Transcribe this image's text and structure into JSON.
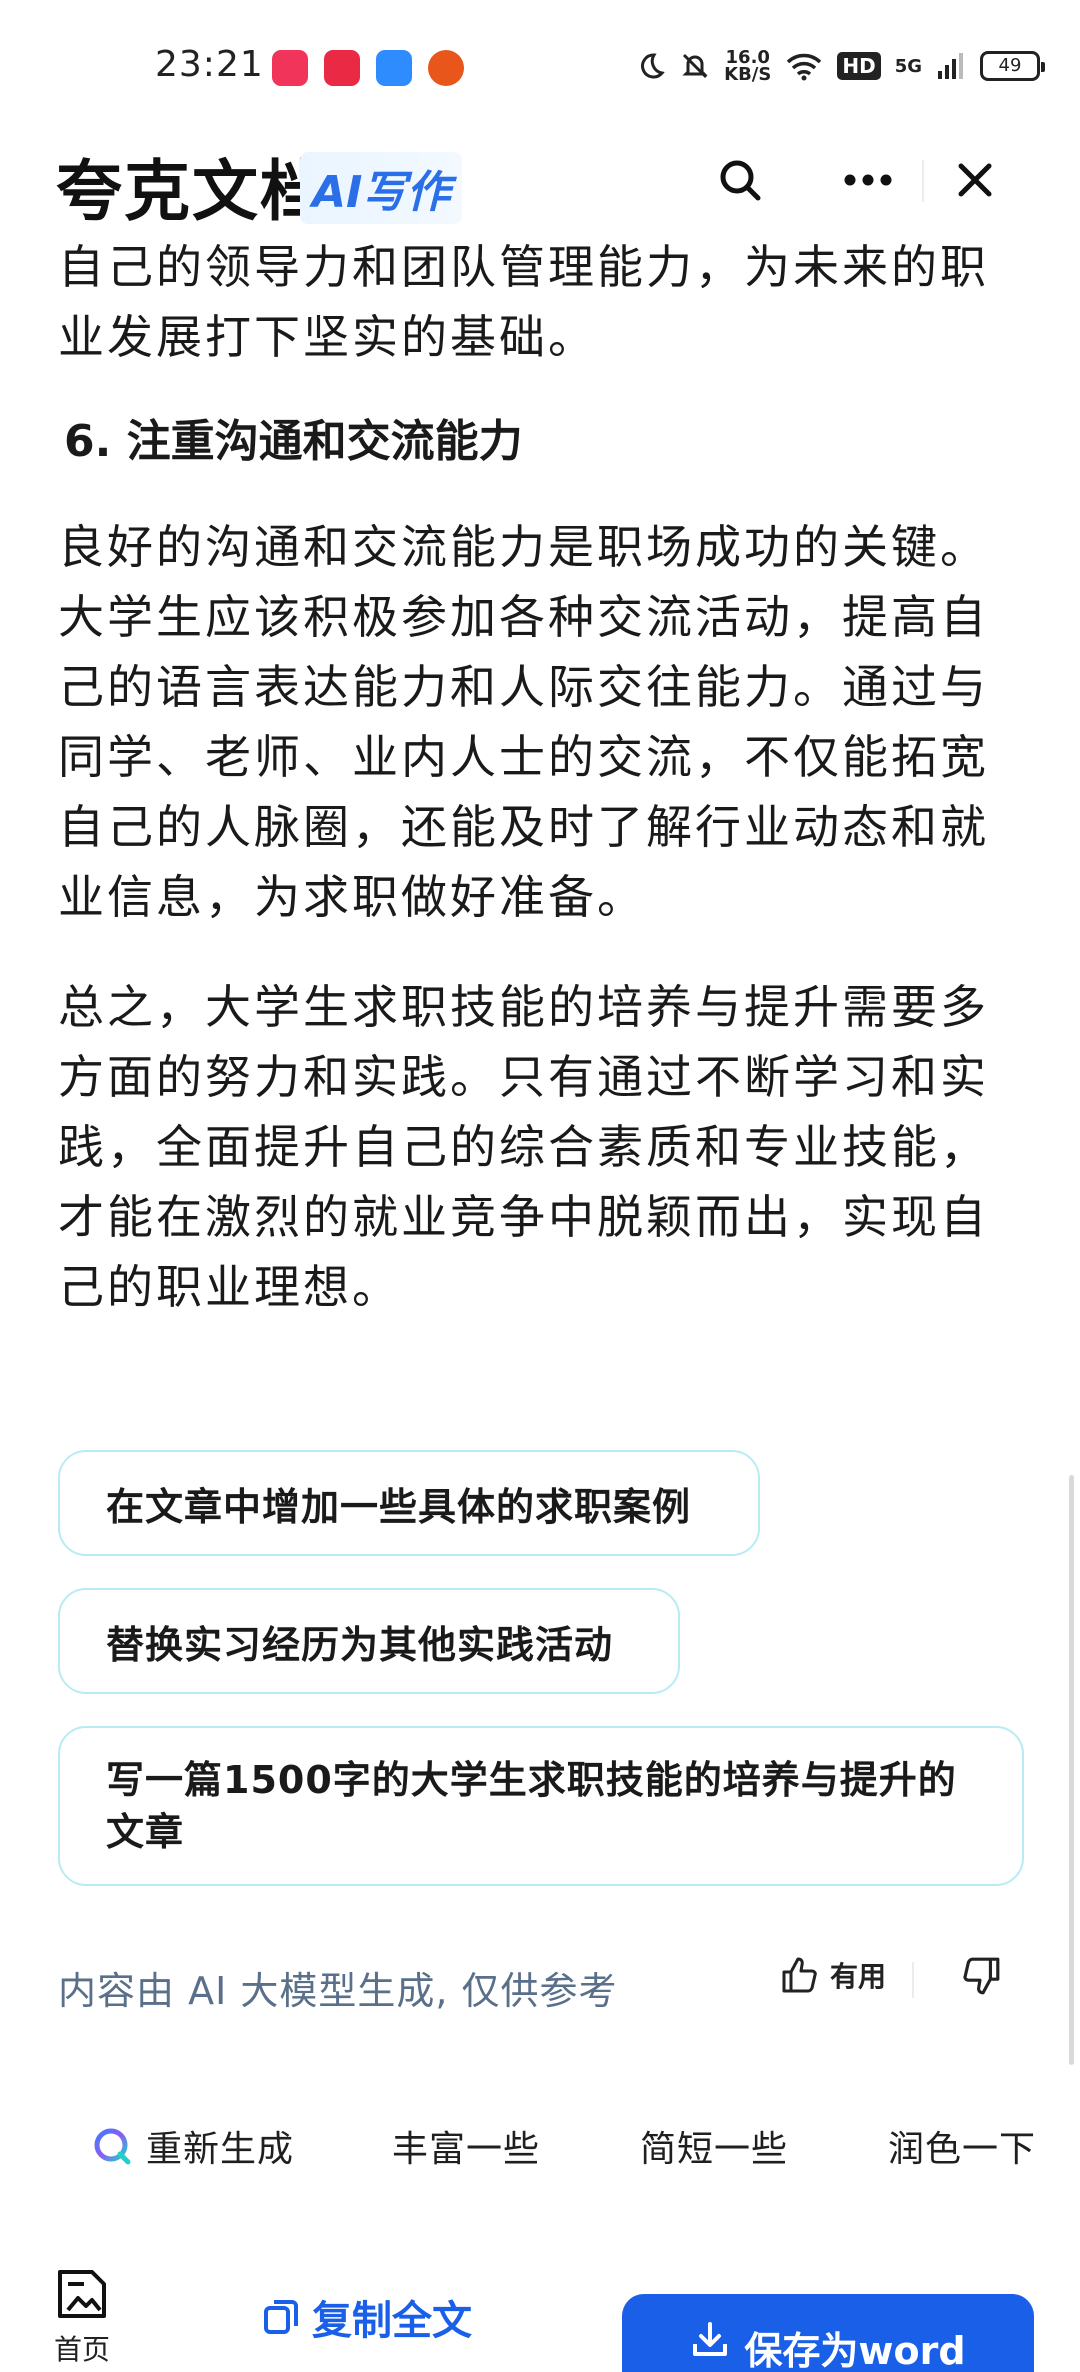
{
  "status_bar": {
    "time": "23:21",
    "network_speed_value": "16.0",
    "network_speed_unit": "KB/S",
    "hd_label": "HD",
    "network_type": "5G",
    "battery": "49",
    "icons": [
      "moon-icon",
      "mute-bell-icon",
      "wifi-icon",
      "signal-icon"
    ],
    "app_icons": [
      {
        "name": "screen-record-app-icon",
        "color": "#f0345a"
      },
      {
        "name": "xiaohongshu-app-icon",
        "color": "#ea2a45"
      },
      {
        "name": "chat-app-icon",
        "color": "#2f8cff"
      },
      {
        "name": "game-app-icon",
        "color": "#e8561c"
      }
    ]
  },
  "header": {
    "brand": "夸克文档",
    "ai_badge": "AI写作",
    "icons": [
      "search-icon",
      "more-icon",
      "close-icon"
    ]
  },
  "content": {
    "paragraph_intro_tail": "自己的领导力和团队管理能力，为未来的职业发展打下坚实的基础。",
    "section_heading": "6. 注重沟通和交流能力",
    "paragraph_communication": "良好的沟通和交流能力是职场成功的关键。大学生应该积极参加各种交流活动，提高自己的语言表达能力和人际交往能力。通过与同学、老师、业内人士的交流，不仅能拓宽自己的人脉圈，还能及时了解行业动态和就业信息，为求职做好准备。",
    "paragraph_conclusion": "总之，大学生求职技能的培养与提升需要多方面的努力和实践。只有通过不断学习和实践，全面提升自己的综合素质和专业技能，才能在激烈的就业竞争中脱颖而出，实现自己的职业理想。"
  },
  "suggestions": [
    "在文章中增加一些具体的求职案例",
    "替换实习经历为其他实践活动",
    "写一篇1500字的大学生求职技能的培养与提升的文章"
  ],
  "feedback": {
    "disclaimer": "内容由 AI 大模型生成, 仅供参考",
    "useful_label": "有用"
  },
  "actions": {
    "regenerate": "重新生成",
    "enrich": "丰富一些",
    "shorten": "简短一些",
    "polish": "润色一下"
  },
  "bottom_bar": {
    "home_label": "首页",
    "copy_label": "复制全文",
    "save_label": "保存为word"
  },
  "colors": {
    "accent": "#1a5fe8",
    "suggestion_border": "#b8ecf3",
    "disclaimer_text": "#5a6f8a"
  }
}
